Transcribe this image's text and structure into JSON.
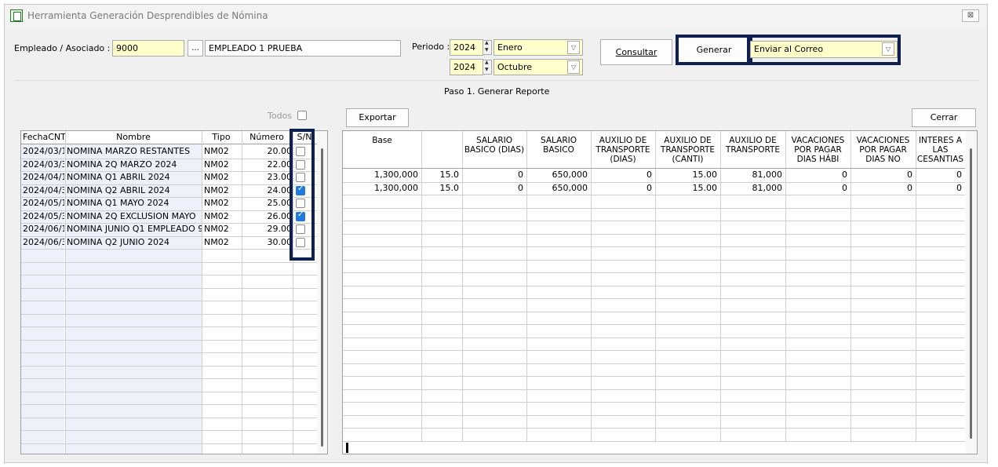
{
  "window": {
    "title": "Herramienta Generación Desprendibles de Nómina",
    "close_symbol": "⊠"
  },
  "header": {
    "employee_label": "Empleado / Asociado :",
    "employee_code": "9000",
    "lookup_button": "...",
    "employee_name": "EMPLEADO 1 PRUEBA",
    "periodo_label": "Periodo :",
    "start_year": "2024",
    "start_month": "Enero",
    "end_year": "2024",
    "end_month": "Octubre",
    "consultar_button": "Consultar",
    "generar_button": "Generar",
    "send_option": "Enviar al Correo"
  },
  "step_title": "Paso 1. Generar Reporte",
  "left_panel": {
    "todos_label": "Todos",
    "columns": [
      "FechaCNT",
      "Nombre",
      "Tipo",
      "Número",
      "S/N"
    ],
    "rows": [
      {
        "fecha": "2024/03/1",
        "nombre": "NOMINA MARZO RESTANTES",
        "tipo": "NM02",
        "numero": "20.00",
        "checked": false
      },
      {
        "fecha": "2024/03/3",
        "nombre": "NOMINA 2Q MARZO 2024",
        "tipo": "NM02",
        "numero": "22.00",
        "checked": false
      },
      {
        "fecha": "2024/04/1",
        "nombre": "NOMINA Q1 ABRIL 2024",
        "tipo": "NM02",
        "numero": "23.00",
        "checked": false
      },
      {
        "fecha": "2024/04/3",
        "nombre": "NOMINA Q2 ABRIL 2024",
        "tipo": "NM02",
        "numero": "24.00",
        "checked": true
      },
      {
        "fecha": "2024/05/1",
        "nombre": "NOMINA Q1 MAYO 2024",
        "tipo": "NM02",
        "numero": "25.00",
        "checked": false
      },
      {
        "fecha": "2024/05/3",
        "nombre": "NOMINA 2Q EXCLUSION MAYO",
        "tipo": "NM02",
        "numero": "26.00",
        "checked": true
      },
      {
        "fecha": "2024/06/1",
        "nombre": "NOMINA JUNIO Q1 EMPLEADO 9",
        "tipo": "NM02",
        "numero": "29.00",
        "checked": false
      },
      {
        "fecha": "2024/06/3",
        "nombre": "NOMINA Q2 JUNIO 2024",
        "tipo": "NM02",
        "numero": "30.00",
        "checked": false
      }
    ]
  },
  "right_panel": {
    "exportar_button": "Exportar",
    "cerrar_button": "Cerrar",
    "columns": [
      "Base",
      "",
      "SALARIO BASICO (DIAS)",
      "SALARIO BASICO",
      "AUXILIO DE TRANSPORTE (DIAS)",
      "AUXILIO DE TRANSPORTE (CANTI)",
      "AUXILIO DE TRANSPORTE",
      "VACACIONES POR PAGAR DIAS HÁBI",
      "VACACIONES POR PAGAR DIAS NO",
      "INTERES A LAS CESANTIAS"
    ],
    "rows": [
      [
        "1,300,000",
        "15.0",
        "0",
        "650,000",
        "0",
        "15.00",
        "81,000",
        "0",
        "0",
        "0"
      ],
      [
        "1,300,000",
        "15.0",
        "0",
        "650,000",
        "0",
        "15.00",
        "81,000",
        "0",
        "0",
        "0"
      ]
    ]
  }
}
